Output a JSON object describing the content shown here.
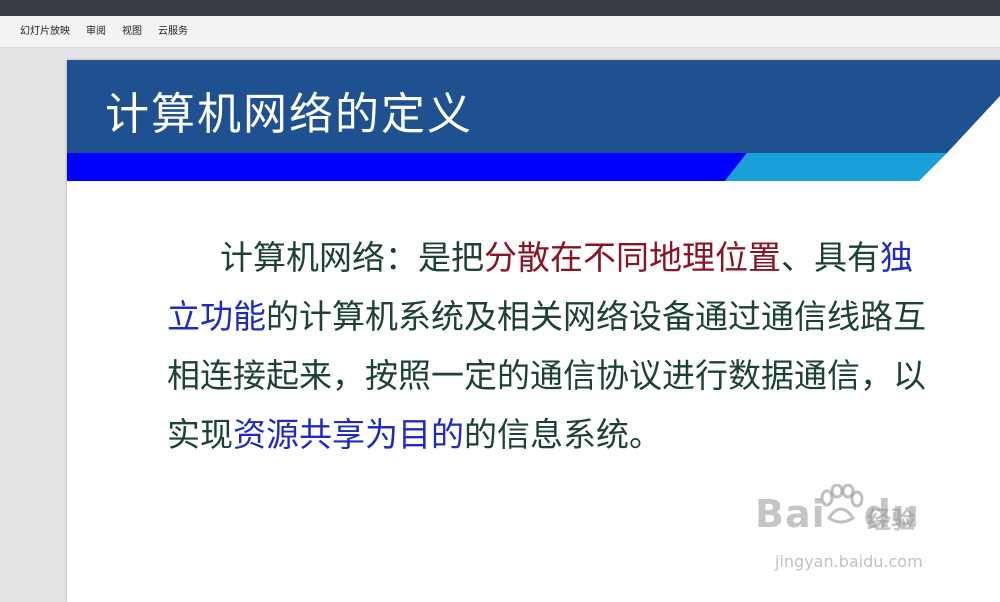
{
  "menu": {
    "items": [
      "幻灯片放映",
      "审阅",
      "视图",
      "云服务"
    ]
  },
  "slide": {
    "title": "计算机网络的定义",
    "body": {
      "p1": "计算机网络：是把",
      "h1": "分散在不同地理位置",
      "p2": "、具有",
      "h2": "独立功能",
      "p3": "的计算机系统及相关网络设备通过通信线路互相连接起来，按照一定的通信协议进行数据通信，以实现",
      "h3": "资源共享为目的",
      "p4": "的信息系统。"
    }
  },
  "watermark": {
    "brand": "Bai",
    "brand2": "du",
    "suffix": "经验",
    "url": "jingyan.baidu.com"
  },
  "colors": {
    "header_blue": "#1f5190",
    "stripe_blue": "#0000ff",
    "stripe_cyan": "#1aa0d8",
    "text_green": "#1d4234",
    "highlight_red": "#8a1424",
    "highlight_blue": "#1f2bbf"
  }
}
